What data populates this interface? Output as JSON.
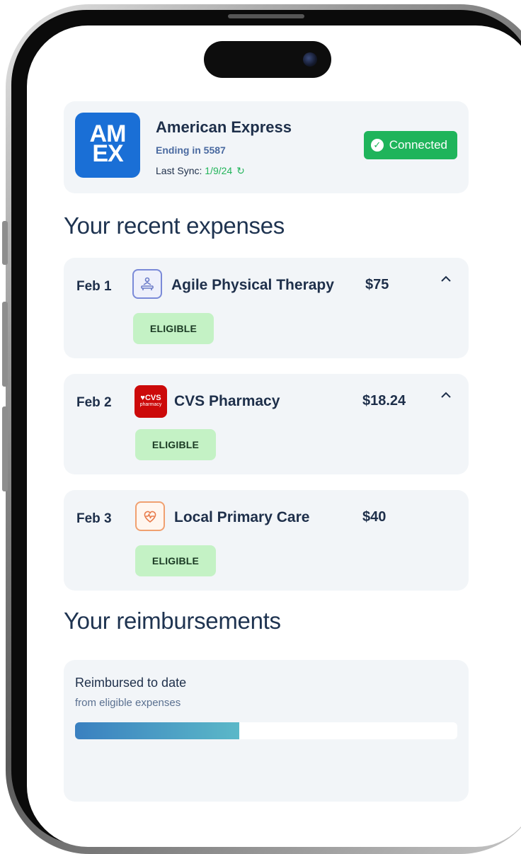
{
  "account": {
    "logo_line1": "AM",
    "logo_line2": "EX",
    "name": "American Express",
    "ending": "Ending in 5587",
    "last_sync_label": "Last Sync:",
    "last_sync_date": "1/9/24",
    "status": "Connected"
  },
  "expenses_section": {
    "title": "Your recent expenses",
    "items": [
      {
        "date": "Feb 1",
        "icon": "physical-therapy-icon",
        "name": "Agile Physical Therapy",
        "amount": "$75",
        "status": "ELIGIBLE",
        "expanded": true
      },
      {
        "date": "Feb 2",
        "icon": "cvs-pharmacy-logo",
        "logo_text": "♥CVS",
        "logo_sub": "pharmacy",
        "name": "CVS Pharmacy",
        "amount": "$18.24",
        "status": "ELIGIBLE",
        "expanded": true
      },
      {
        "date": "Feb 3",
        "icon": "heart-monitor-icon",
        "name": "Local Primary Care",
        "amount": "$40",
        "status": "ELIGIBLE",
        "expanded": false
      }
    ]
  },
  "reimbursements": {
    "title": "Your reimbursements",
    "label": "Reimbursed to date",
    "sub": "from eligible expenses",
    "progress": 0.43
  },
  "colors": {
    "amex_blue": "#1a6fd6",
    "connected_green": "#1fb45b",
    "eligible_bg": "#c4f2c5",
    "heading": "#1e3350"
  }
}
